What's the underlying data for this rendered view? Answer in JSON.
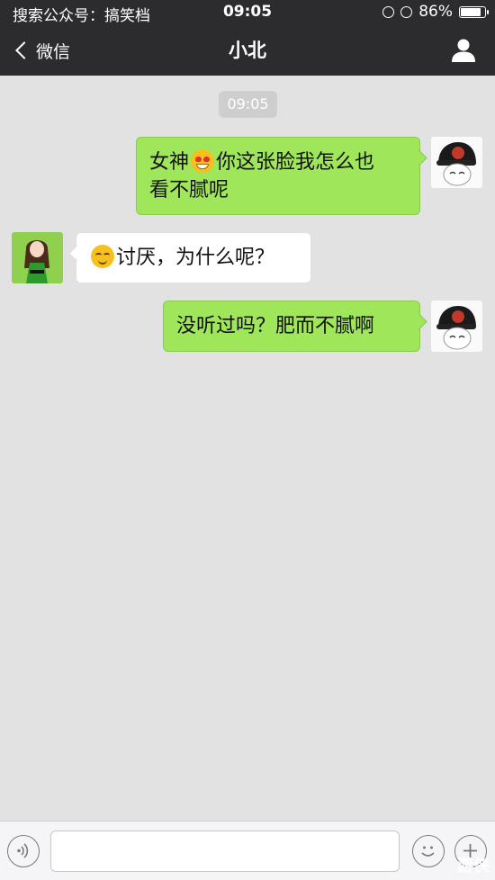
{
  "status_bar": {
    "carrier": "搜索公众号：搞笑档",
    "time": "09:05",
    "battery": "86%",
    "battery_level": 0.86
  },
  "nav": {
    "back_label": "微信",
    "title": "小北",
    "profile_icon": "person-icon"
  },
  "chat": {
    "timestamp": "09:05",
    "messages": [
      {
        "side": "right",
        "parts": [
          "女神",
          "你这张脸我怎么也",
          "看不腻呢"
        ]
      },
      {
        "side": "left",
        "parts": [
          "讨厌，为什么呢？"
        ]
      },
      {
        "side": "right",
        "parts": [
          "没听过吗？肥而不腻啊"
        ]
      }
    ]
  },
  "input_bar": {
    "placeholder": "",
    "watermark": "游侠"
  },
  "colors": {
    "bar_bg": "#2c2c2e",
    "chat_bg": "#e2e2e2",
    "sent_bubble": "#9fe65a",
    "received_bubble": "#ffffff"
  }
}
